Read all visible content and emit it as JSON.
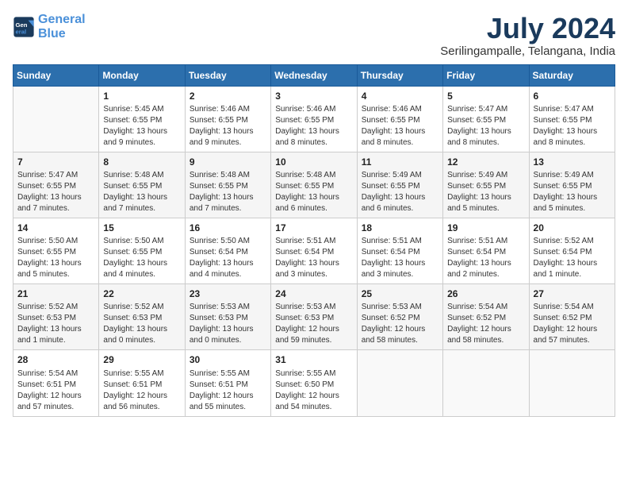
{
  "header": {
    "logo_line1": "General",
    "logo_line2": "Blue",
    "title": "July 2024",
    "subtitle": "Serilingampalle, Telangana, India"
  },
  "calendar": {
    "days_of_week": [
      "Sunday",
      "Monday",
      "Tuesday",
      "Wednesday",
      "Thursday",
      "Friday",
      "Saturday"
    ],
    "weeks": [
      [
        {
          "day": "",
          "content": ""
        },
        {
          "day": "1",
          "content": "Sunrise: 5:45 AM\nSunset: 6:55 PM\nDaylight: 13 hours\nand 9 minutes."
        },
        {
          "day": "2",
          "content": "Sunrise: 5:46 AM\nSunset: 6:55 PM\nDaylight: 13 hours\nand 9 minutes."
        },
        {
          "day": "3",
          "content": "Sunrise: 5:46 AM\nSunset: 6:55 PM\nDaylight: 13 hours\nand 8 minutes."
        },
        {
          "day": "4",
          "content": "Sunrise: 5:46 AM\nSunset: 6:55 PM\nDaylight: 13 hours\nand 8 minutes."
        },
        {
          "day": "5",
          "content": "Sunrise: 5:47 AM\nSunset: 6:55 PM\nDaylight: 13 hours\nand 8 minutes."
        },
        {
          "day": "6",
          "content": "Sunrise: 5:47 AM\nSunset: 6:55 PM\nDaylight: 13 hours\nand 8 minutes."
        }
      ],
      [
        {
          "day": "7",
          "content": "Sunrise: 5:47 AM\nSunset: 6:55 PM\nDaylight: 13 hours\nand 7 minutes."
        },
        {
          "day": "8",
          "content": "Sunrise: 5:48 AM\nSunset: 6:55 PM\nDaylight: 13 hours\nand 7 minutes."
        },
        {
          "day": "9",
          "content": "Sunrise: 5:48 AM\nSunset: 6:55 PM\nDaylight: 13 hours\nand 7 minutes."
        },
        {
          "day": "10",
          "content": "Sunrise: 5:48 AM\nSunset: 6:55 PM\nDaylight: 13 hours\nand 6 minutes."
        },
        {
          "day": "11",
          "content": "Sunrise: 5:49 AM\nSunset: 6:55 PM\nDaylight: 13 hours\nand 6 minutes."
        },
        {
          "day": "12",
          "content": "Sunrise: 5:49 AM\nSunset: 6:55 PM\nDaylight: 13 hours\nand 5 minutes."
        },
        {
          "day": "13",
          "content": "Sunrise: 5:49 AM\nSunset: 6:55 PM\nDaylight: 13 hours\nand 5 minutes."
        }
      ],
      [
        {
          "day": "14",
          "content": "Sunrise: 5:50 AM\nSunset: 6:55 PM\nDaylight: 13 hours\nand 5 minutes."
        },
        {
          "day": "15",
          "content": "Sunrise: 5:50 AM\nSunset: 6:55 PM\nDaylight: 13 hours\nand 4 minutes."
        },
        {
          "day": "16",
          "content": "Sunrise: 5:50 AM\nSunset: 6:54 PM\nDaylight: 13 hours\nand 4 minutes."
        },
        {
          "day": "17",
          "content": "Sunrise: 5:51 AM\nSunset: 6:54 PM\nDaylight: 13 hours\nand 3 minutes."
        },
        {
          "day": "18",
          "content": "Sunrise: 5:51 AM\nSunset: 6:54 PM\nDaylight: 13 hours\nand 3 minutes."
        },
        {
          "day": "19",
          "content": "Sunrise: 5:51 AM\nSunset: 6:54 PM\nDaylight: 13 hours\nand 2 minutes."
        },
        {
          "day": "20",
          "content": "Sunrise: 5:52 AM\nSunset: 6:54 PM\nDaylight: 13 hours\nand 1 minute."
        }
      ],
      [
        {
          "day": "21",
          "content": "Sunrise: 5:52 AM\nSunset: 6:53 PM\nDaylight: 13 hours\nand 1 minute."
        },
        {
          "day": "22",
          "content": "Sunrise: 5:52 AM\nSunset: 6:53 PM\nDaylight: 13 hours\nand 0 minutes."
        },
        {
          "day": "23",
          "content": "Sunrise: 5:53 AM\nSunset: 6:53 PM\nDaylight: 13 hours\nand 0 minutes."
        },
        {
          "day": "24",
          "content": "Sunrise: 5:53 AM\nSunset: 6:53 PM\nDaylight: 12 hours\nand 59 minutes."
        },
        {
          "day": "25",
          "content": "Sunrise: 5:53 AM\nSunset: 6:52 PM\nDaylight: 12 hours\nand 58 minutes."
        },
        {
          "day": "26",
          "content": "Sunrise: 5:54 AM\nSunset: 6:52 PM\nDaylight: 12 hours\nand 58 minutes."
        },
        {
          "day": "27",
          "content": "Sunrise: 5:54 AM\nSunset: 6:52 PM\nDaylight: 12 hours\nand 57 minutes."
        }
      ],
      [
        {
          "day": "28",
          "content": "Sunrise: 5:54 AM\nSunset: 6:51 PM\nDaylight: 12 hours\nand 57 minutes."
        },
        {
          "day": "29",
          "content": "Sunrise: 5:55 AM\nSunset: 6:51 PM\nDaylight: 12 hours\nand 56 minutes."
        },
        {
          "day": "30",
          "content": "Sunrise: 5:55 AM\nSunset: 6:51 PM\nDaylight: 12 hours\nand 55 minutes."
        },
        {
          "day": "31",
          "content": "Sunrise: 5:55 AM\nSunset: 6:50 PM\nDaylight: 12 hours\nand 54 minutes."
        },
        {
          "day": "",
          "content": ""
        },
        {
          "day": "",
          "content": ""
        },
        {
          "day": "",
          "content": ""
        }
      ]
    ]
  }
}
